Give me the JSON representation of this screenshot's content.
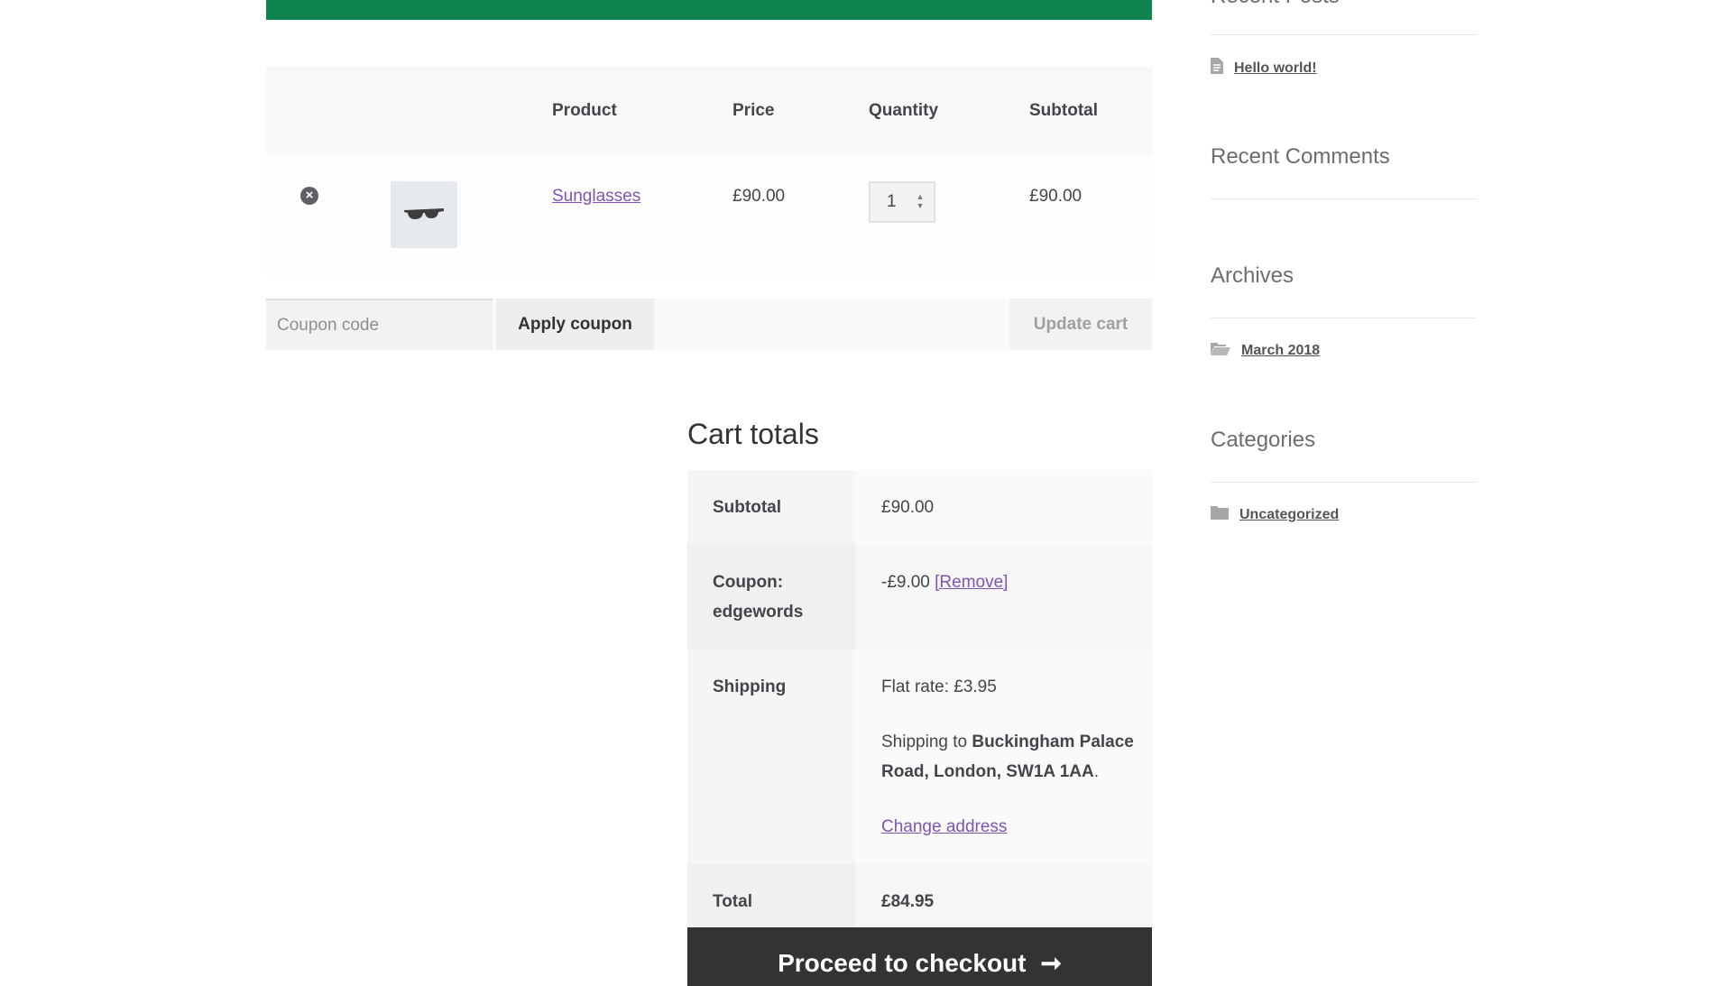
{
  "colors": {
    "notice_bar": "#0f834d",
    "link": "#7f54b3",
    "checkout_bg": "#333333"
  },
  "cart": {
    "headers": {
      "product": "Product",
      "price": "Price",
      "quantity": "Quantity",
      "subtotal": "Subtotal"
    },
    "items": [
      {
        "remove_icon": "remove-circle-icon",
        "thumbnail_icon": "sunglasses-icon",
        "name": "Sunglasses",
        "price": "£90.00",
        "quantity": "1",
        "subtotal": "£90.00"
      }
    ],
    "actions": {
      "coupon_placeholder": "Coupon code",
      "apply_label": "Apply coupon",
      "update_label": "Update cart"
    }
  },
  "totals": {
    "heading": "Cart totals",
    "subtotal_label": "Subtotal",
    "subtotal_value": "£90.00",
    "coupon_label_line1": "Coupon:",
    "coupon_label_line2": "edgewords",
    "coupon_value": "-£9.00",
    "coupon_remove": "[Remove]",
    "shipping_label": "Shipping",
    "shipping_method": "Flat rate: £3.95",
    "shipping_to_prefix": "Shipping to ",
    "shipping_address": "Buckingham Palace Road, London, SW1A 1AA",
    "shipping_to_suffix": ".",
    "change_address": "Change address",
    "total_label": "Total",
    "total_value": "£84.95",
    "checkout_label": "Proceed to checkout",
    "checkout_icon": "arrow-right-icon"
  },
  "sidebar": {
    "recent_posts_title": "Recent Posts",
    "recent_posts": [
      {
        "label": "Hello world!",
        "icon": "document-icon"
      }
    ],
    "recent_comments_title": "Recent Comments",
    "archives_title": "Archives",
    "archives": [
      {
        "label": "March 2018",
        "icon": "folder-open-icon"
      }
    ],
    "categories_title": "Categories",
    "categories": [
      {
        "label": "Uncategorized",
        "icon": "folder-icon"
      }
    ]
  }
}
